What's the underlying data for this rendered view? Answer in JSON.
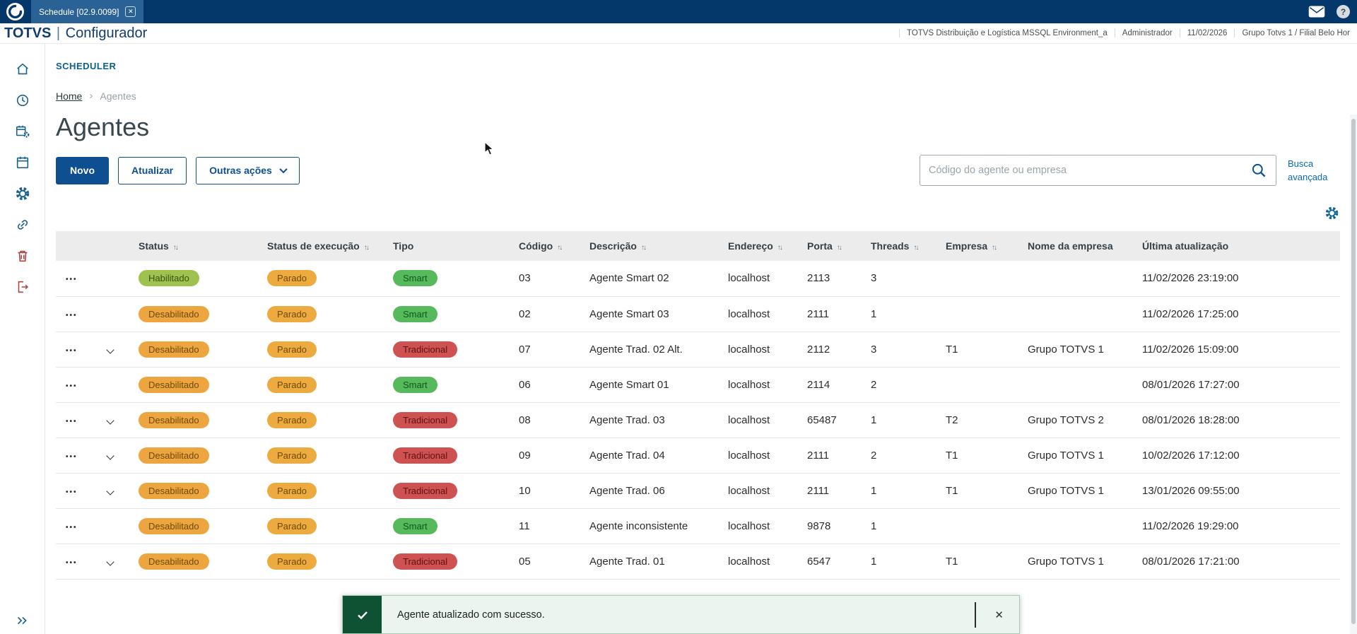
{
  "topbar": {
    "tab_title": "Schedule [02.9.0099]"
  },
  "header": {
    "brand_bold": "TOTVS",
    "brand_sep": "|",
    "brand_product": "Configurador",
    "environment": "TOTVS Distribuição e Logística MSSQL Environment_a",
    "user": "Administrador",
    "date": "11/02/2026",
    "company": "Grupo Totvs 1 / Filial Belo Hor"
  },
  "page": {
    "module": "SCHEDULER",
    "breadcrumb": [
      "Home",
      "Agentes"
    ],
    "title": "Agentes",
    "actions": {
      "new": "Novo",
      "refresh": "Atualizar",
      "more": "Outras ações"
    },
    "search_placeholder": "Código do agente ou empresa",
    "advanced_search": "Busca avançada"
  },
  "icons": {
    "close": "✕",
    "help": "?",
    "sort": "↑↓",
    "row_actions": "•••",
    "breadcrumb_sep": "›"
  },
  "table": {
    "columns": [
      {
        "key": "actions",
        "label": "",
        "sortable": false
      },
      {
        "key": "expand",
        "label": "",
        "sortable": false
      },
      {
        "key": "status",
        "label": "Status",
        "sortable": true
      },
      {
        "key": "exec",
        "label": "Status de execução",
        "sortable": true
      },
      {
        "key": "tipo",
        "label": "Tipo",
        "sortable": false
      },
      {
        "key": "codigo",
        "label": "Código",
        "sortable": true
      },
      {
        "key": "descricao",
        "label": "Descrição",
        "sortable": true
      },
      {
        "key": "endereco",
        "label": "Endereço",
        "sortable": true
      },
      {
        "key": "porta",
        "label": "Porta",
        "sortable": true
      },
      {
        "key": "threads",
        "label": "Threads",
        "sortable": true
      },
      {
        "key": "empresa",
        "label": "Empresa",
        "sortable": true
      },
      {
        "key": "nome_empresa",
        "label": "Nome da empresa",
        "sortable": false
      },
      {
        "key": "ultima",
        "label": "Última atualização",
        "sortable": false
      }
    ],
    "rows": [
      {
        "expandable": false,
        "status": "Habilitado",
        "exec": "Parado",
        "tipo": "Smart",
        "codigo": "03",
        "descricao": "Agente Smart 02",
        "endereco": "localhost",
        "porta": "2113",
        "threads": "3",
        "empresa": "",
        "nome_empresa": "",
        "ultima": "11/02/2026 23:19:00"
      },
      {
        "expandable": false,
        "status": "Desabilitado",
        "exec": "Parado",
        "tipo": "Smart",
        "codigo": "02",
        "descricao": "Agente Smart 03",
        "endereco": "localhost",
        "porta": "2111",
        "threads": "1",
        "empresa": "",
        "nome_empresa": "",
        "ultima": "11/02/2026 17:25:00"
      },
      {
        "expandable": true,
        "status": "Desabilitado",
        "exec": "Parado",
        "tipo": "Tradicional",
        "codigo": "07",
        "descricao": "Agente Trad. 02 Alt.",
        "endereco": "localhost",
        "porta": "2112",
        "threads": "3",
        "empresa": "T1",
        "nome_empresa": "Grupo TOTVS 1",
        "ultima": "11/02/2026 15:09:00"
      },
      {
        "expandable": false,
        "status": "Desabilitado",
        "exec": "Parado",
        "tipo": "Smart",
        "codigo": "06",
        "descricao": "Agente Smart 01",
        "endereco": "localhost",
        "porta": "2114",
        "threads": "2",
        "empresa": "",
        "nome_empresa": "",
        "ultima": "08/01/2026 17:27:00"
      },
      {
        "expandable": true,
        "status": "Desabilitado",
        "exec": "Parado",
        "tipo": "Tradicional",
        "codigo": "08",
        "descricao": "Agente Trad. 03",
        "endereco": "localhost",
        "porta": "65487",
        "threads": "1",
        "empresa": "T2",
        "nome_empresa": "Grupo TOTVS 2",
        "ultima": "08/01/2026 18:28:00"
      },
      {
        "expandable": true,
        "status": "Desabilitado",
        "exec": "Parado",
        "tipo": "Tradicional",
        "codigo": "09",
        "descricao": "Agente Trad. 04",
        "endereco": "localhost",
        "porta": "2111",
        "threads": "2",
        "empresa": "T1",
        "nome_empresa": "Grupo TOTVS 1",
        "ultima": "10/02/2026 17:12:00"
      },
      {
        "expandable": true,
        "status": "Desabilitado",
        "exec": "Parado",
        "tipo": "Tradicional",
        "codigo": "10",
        "descricao": "Agente Trad. 06",
        "endereco": "localhost",
        "porta": "2111",
        "threads": "1",
        "empresa": "T1",
        "nome_empresa": "Grupo TOTVS 1",
        "ultima": "13/01/2026 09:55:00"
      },
      {
        "expandable": false,
        "status": "Desabilitado",
        "exec": "Parado",
        "tipo": "Smart",
        "codigo": "11",
        "descricao": "Agente inconsistente",
        "endereco": "localhost",
        "porta": "9878",
        "threads": "1",
        "empresa": "",
        "nome_empresa": "",
        "ultima": "11/02/2026 19:29:00"
      },
      {
        "expandable": true,
        "status": "Desabilitado",
        "exec": "Parado",
        "tipo": "Tradicional",
        "codigo": "05",
        "descricao": "Agente Trad. 01",
        "endereco": "localhost",
        "porta": "6547",
        "threads": "1",
        "empresa": "T1",
        "nome_empresa": "Grupo TOTVS 1",
        "ultima": "08/01/2026 17:21:00"
      }
    ]
  },
  "toast": {
    "message": "Agente atualizado com sucesso."
  },
  "colors": {
    "topbar": "#04386b",
    "primary": "#0d4f91",
    "badges": {
      "Habilitado": {
        "bg": "#9fc14f",
        "text": "#3c5110"
      },
      "Desabilitado": {
        "bg": "#eda63f",
        "text": "#6f4a06"
      },
      "Parado": {
        "bg": "#edaa3f",
        "text": "#6f4a06"
      },
      "Smart": {
        "bg": "#56b95c",
        "text": "#0e5a1c"
      },
      "Tradicional": {
        "bg": "#cf5252",
        "text": "#5e1010"
      }
    },
    "toast_bg": "#e9f5ee",
    "toast_icon_bg": "#0e5233"
  }
}
